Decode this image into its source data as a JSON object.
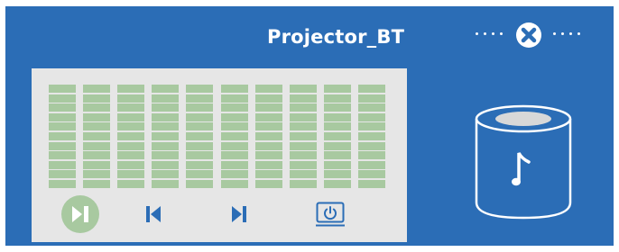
{
  "device": {
    "name": "Projector_BT"
  },
  "connection": {
    "status_icon": "disconnect-x-icon",
    "state": "disconnected"
  },
  "equalizer": {
    "bands": 10,
    "levels": [
      11,
      11,
      11,
      11,
      11,
      11,
      11,
      11,
      11,
      11
    ]
  },
  "controls": {
    "play_pause": {
      "icon": "play-pause-icon"
    },
    "previous": {
      "icon": "skip-previous-icon"
    },
    "next": {
      "icon": "skip-next-icon"
    },
    "power": {
      "icon": "power-icon"
    }
  },
  "speaker": {
    "icon": "speaker-music-icon"
  },
  "colors": {
    "background": "#2b6db6",
    "screen": "#e6e6e6",
    "eq_segment": "#a8c9a0",
    "control_blue": "#2b6db6",
    "play_button": "#a8c9a0",
    "text": "#ffffff"
  }
}
